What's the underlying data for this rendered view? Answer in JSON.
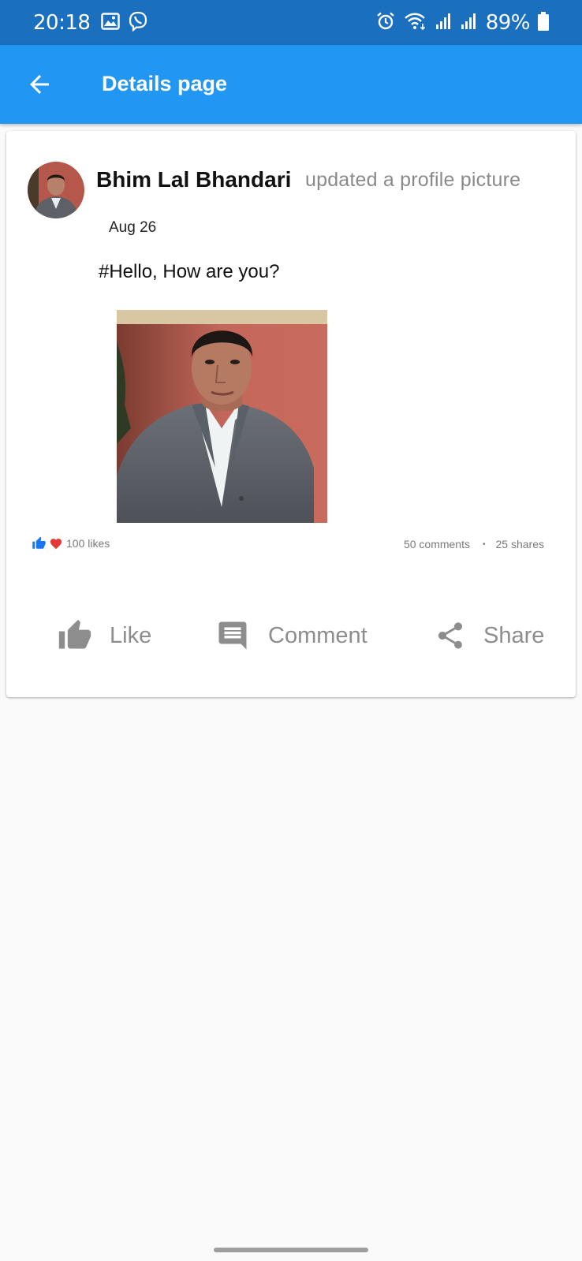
{
  "status_bar": {
    "time": "20:18",
    "battery": "89%",
    "icons_left": [
      "gallery-icon",
      "viber-icon"
    ],
    "icons_right": [
      "alarm-icon",
      "wifi-icon",
      "signal-icon",
      "signal-icon",
      "battery-icon"
    ]
  },
  "app_bar": {
    "title": "Details page",
    "background": "#2196f3"
  },
  "post": {
    "author": "Bhim Lal Bhandari",
    "action": "updated a profile picture",
    "date": "Aug 26",
    "text": "#Hello, How are you?",
    "likes": "100 likes",
    "comments": "50 comments",
    "separator": "•",
    "shares": "25 shares",
    "actions": {
      "like": "Like",
      "comment": "Comment",
      "share": "Share"
    }
  },
  "colors": {
    "status_bar": "#1a6fbf",
    "accent": "#2196f3",
    "like_blue": "#1877f2",
    "heart_red": "#e53935",
    "action_gray": "#8d8d8d"
  }
}
